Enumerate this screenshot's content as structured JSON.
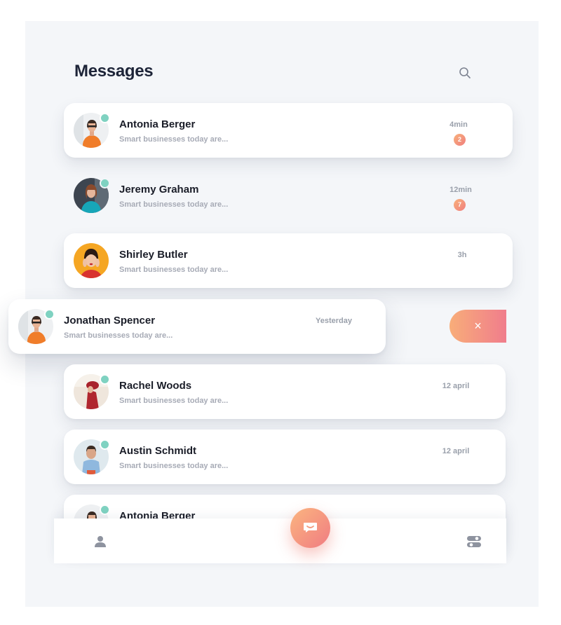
{
  "header": {
    "title": "Messages",
    "search_icon": "search-icon"
  },
  "conversations": [
    {
      "name": "Antonia Berger",
      "preview": "Smart businesses today are...",
      "time": "4min",
      "unread": "2",
      "online": true
    },
    {
      "name": "Jeremy Graham",
      "preview": "Smart businesses today are...",
      "time": "12min",
      "unread": "7",
      "online": true
    },
    {
      "name": "Shirley Butler",
      "preview": "Smart businesses today are...",
      "time": "3h",
      "unread": "",
      "online": false
    },
    {
      "name": "Jonathan Spencer",
      "preview": "Smart businesses today are...",
      "time": "Yesterday",
      "unread": "",
      "online": true
    },
    {
      "name": "Rachel Woods",
      "preview": "Smart businesses today are...",
      "time": "12 april",
      "unread": "",
      "online": true
    },
    {
      "name": "Austin Schmidt",
      "preview": "Smart businesses today are...",
      "time": "12 april",
      "unread": "",
      "online": true
    },
    {
      "name": "Antonia Berger",
      "preview": "",
      "time": "",
      "unread": "",
      "online": true
    }
  ],
  "swipe_action": {
    "label": "×",
    "icon": "close-icon"
  },
  "bottom_nav": {
    "left_icon": "user-icon",
    "center_icon": "message-icon",
    "right_icon": "settings-toggle-icon"
  },
  "colors": {
    "accent_start": "#f8b17b",
    "accent_end": "#f07e7e",
    "online": "#7fd2c1",
    "title": "#1d2438",
    "background": "#f4f6f9"
  }
}
